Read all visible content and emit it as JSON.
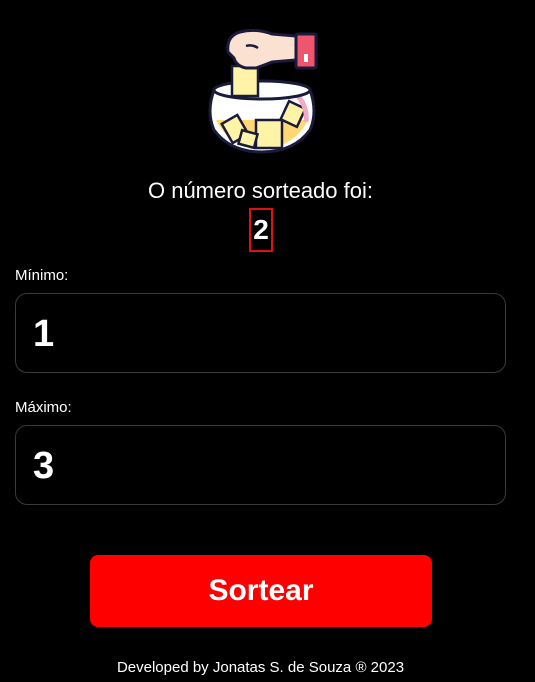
{
  "result": {
    "label": "O número sorteado foi:",
    "value": "2"
  },
  "minimum": {
    "label": "Mínimo:",
    "value": "1"
  },
  "maximum": {
    "label": "Máximo:",
    "value": "3"
  },
  "button": {
    "label": "Sortear"
  },
  "footer": {
    "text": "Developed by Jonatas S. de Souza ® 2023"
  },
  "colors": {
    "background": "#000000",
    "accent": "#ff0000",
    "text": "#ffffff",
    "field_border": "#3a3a3a"
  },
  "icons": {
    "illustration": "hand-dropping-ticket-into-raffle-bowl-icon"
  }
}
